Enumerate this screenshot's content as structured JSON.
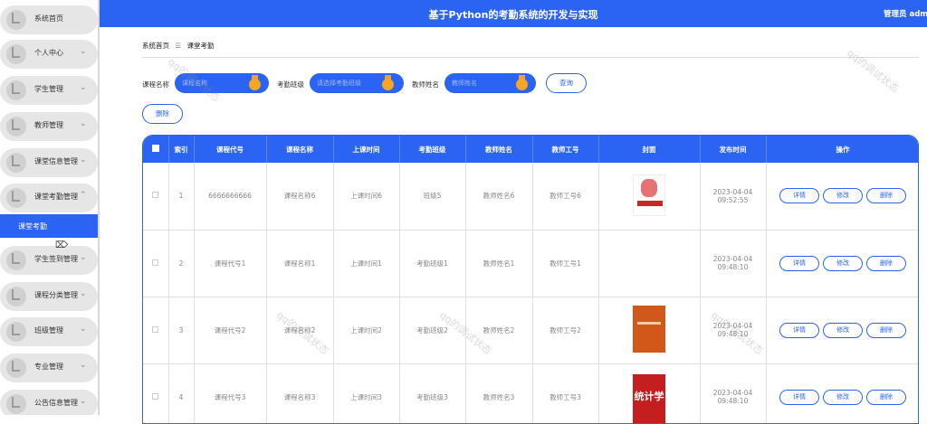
{
  "header": {
    "title": "基于Python的考勤系统的开发与实现",
    "user_label": "管理员 admin  退出"
  },
  "sidebar": {
    "items": [
      {
        "label": "系统首页",
        "chevron": ""
      },
      {
        "label": "个人中心",
        "chevron": "⌄"
      },
      {
        "label": "学生管理",
        "chevron": "⌄"
      },
      {
        "label": "教师管理",
        "chevron": "⌄"
      },
      {
        "label": "课堂信息管理",
        "chevron": "⌄"
      },
      {
        "label": "课堂考勤管理",
        "chevron": "⌃"
      },
      {
        "label": "学生签到管理",
        "chevron": "⌄"
      },
      {
        "label": "课程分类管理",
        "chevron": "⌄"
      },
      {
        "label": "班级管理",
        "chevron": "⌄"
      },
      {
        "label": "专业管理",
        "chevron": "⌄"
      },
      {
        "label": "公告信息管理",
        "chevron": "⌄"
      }
    ],
    "active_sub": "课堂考勤"
  },
  "breadcrumb": {
    "home": "系统首页",
    "separator": "☰",
    "current": "课堂考勤"
  },
  "filters": {
    "course_name": {
      "label": "课程名称",
      "placeholder": "课程名称"
    },
    "class": {
      "label": "考勤班级",
      "placeholder": "请选择考勤班级"
    },
    "teacher": {
      "label": "教师姓名",
      "placeholder": "教师姓名"
    },
    "search_label": "查询",
    "delete_label": "删除"
  },
  "table": {
    "headers": [
      "",
      "索引",
      "课程代号",
      "课程名称",
      "上课时间",
      "考勤班级",
      "教师姓名",
      "教师工号",
      "封面",
      "发布时间",
      "操作"
    ],
    "actions": {
      "detail": "详情",
      "edit": "修改",
      "delete": "删除"
    },
    "rows": [
      {
        "index": "1",
        "code": "6666666666",
        "name": "课程名称6",
        "time": "上课时间6",
        "class": "班级5",
        "teacher": "教师姓名6",
        "teacher_no": "教师工号6",
        "published": "2023-04-04 09:52:55",
        "cover": "book-cover-1"
      },
      {
        "index": "2",
        "code": "课程代号1",
        "name": "课程名称1",
        "time": "上课时间1",
        "class": "考勤班级1",
        "teacher": "教师姓名1",
        "teacher_no": "教师工号1",
        "published": "2023-04-04 09:48:10",
        "cover": "book-cover-2"
      },
      {
        "index": "3",
        "code": "课程代号2",
        "name": "课程名称2",
        "time": "上课时间2",
        "class": "考勤班级2",
        "teacher": "教师姓名2",
        "teacher_no": "教师工号2",
        "published": "2023-04-04 09:48:10",
        "cover": "book-cover-3"
      },
      {
        "index": "4",
        "code": "课程代号3",
        "name": "课程名称3",
        "time": "上课时间3",
        "class": "考勤班级3",
        "teacher": "教师姓名3",
        "teacher_no": "教师工号3",
        "published": "2023-04-04 09:48:10",
        "cover": "book-cover-4",
        "cover_text": "统计学"
      }
    ]
  },
  "watermark": "qq的调试状态",
  "colors": {
    "primary": "#2b63f2",
    "medal": "#f5a623"
  }
}
